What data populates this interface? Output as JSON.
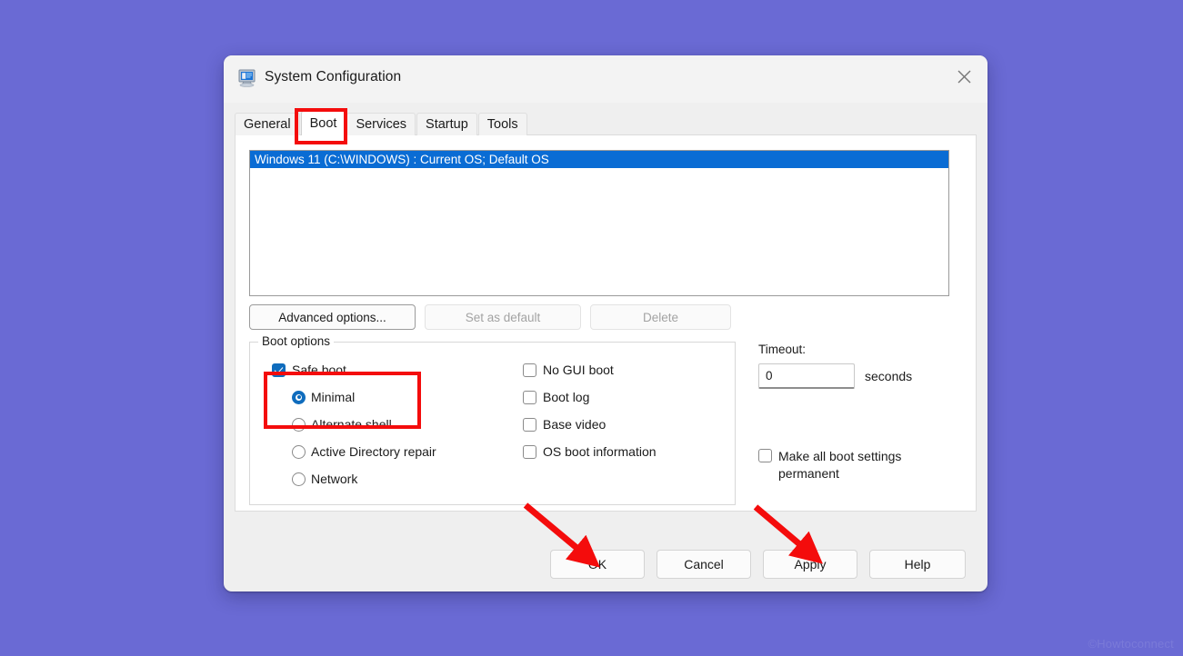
{
  "background": {
    "color": "#6a6ad4"
  },
  "watermark": {
    "text": "©Howtoconnect"
  },
  "window": {
    "title": "System Configuration",
    "icon": "system-configuration-icon",
    "close_label": "×"
  },
  "tabs": [
    {
      "label": "General",
      "active": false
    },
    {
      "label": "Boot",
      "active": true
    },
    {
      "label": "Services",
      "active": false
    },
    {
      "label": "Startup",
      "active": false
    },
    {
      "label": "Tools",
      "active": false
    }
  ],
  "os_list": {
    "items": [
      {
        "text": "Windows 11 (C:\\WINDOWS) : Current OS; Default OS",
        "selected": true
      }
    ],
    "selection_color": "#0a6cd4"
  },
  "mid_buttons": [
    {
      "label": "Advanced options...",
      "enabled": true
    },
    {
      "label": "Set as default",
      "enabled": false
    },
    {
      "label": "Delete",
      "enabled": false
    }
  ],
  "boot_options": {
    "legend": "Boot options",
    "safe_boot": {
      "label": "Safe boot",
      "checked": true
    },
    "safe_boot_modes": [
      {
        "label": "Minimal",
        "selected": true
      },
      {
        "label": "Alternate shell",
        "selected": false
      },
      {
        "label": "Active Directory repair",
        "selected": false
      },
      {
        "label": "Network",
        "selected": false
      }
    ],
    "flags": [
      {
        "label": "No GUI boot",
        "checked": false
      },
      {
        "label": "Boot log",
        "checked": false
      },
      {
        "label": "Base video",
        "checked": false
      },
      {
        "label": "OS boot information",
        "checked": false
      }
    ]
  },
  "timeout": {
    "label": "Timeout:",
    "value": "0",
    "placeholder": "",
    "units": "seconds"
  },
  "permanent": {
    "label": "Make all boot settings permanent",
    "checked": false
  },
  "footer_buttons": [
    {
      "label": "OK"
    },
    {
      "label": "Cancel"
    },
    {
      "label": "Apply"
    },
    {
      "label": "Help"
    }
  ],
  "annotations": {
    "color": "#f40c0c",
    "boxes": [
      {
        "target": "Boot tab"
      },
      {
        "target": "Safe boot / Minimal"
      }
    ],
    "arrows": [
      {
        "target": "OK"
      },
      {
        "target": "Apply"
      }
    ]
  }
}
